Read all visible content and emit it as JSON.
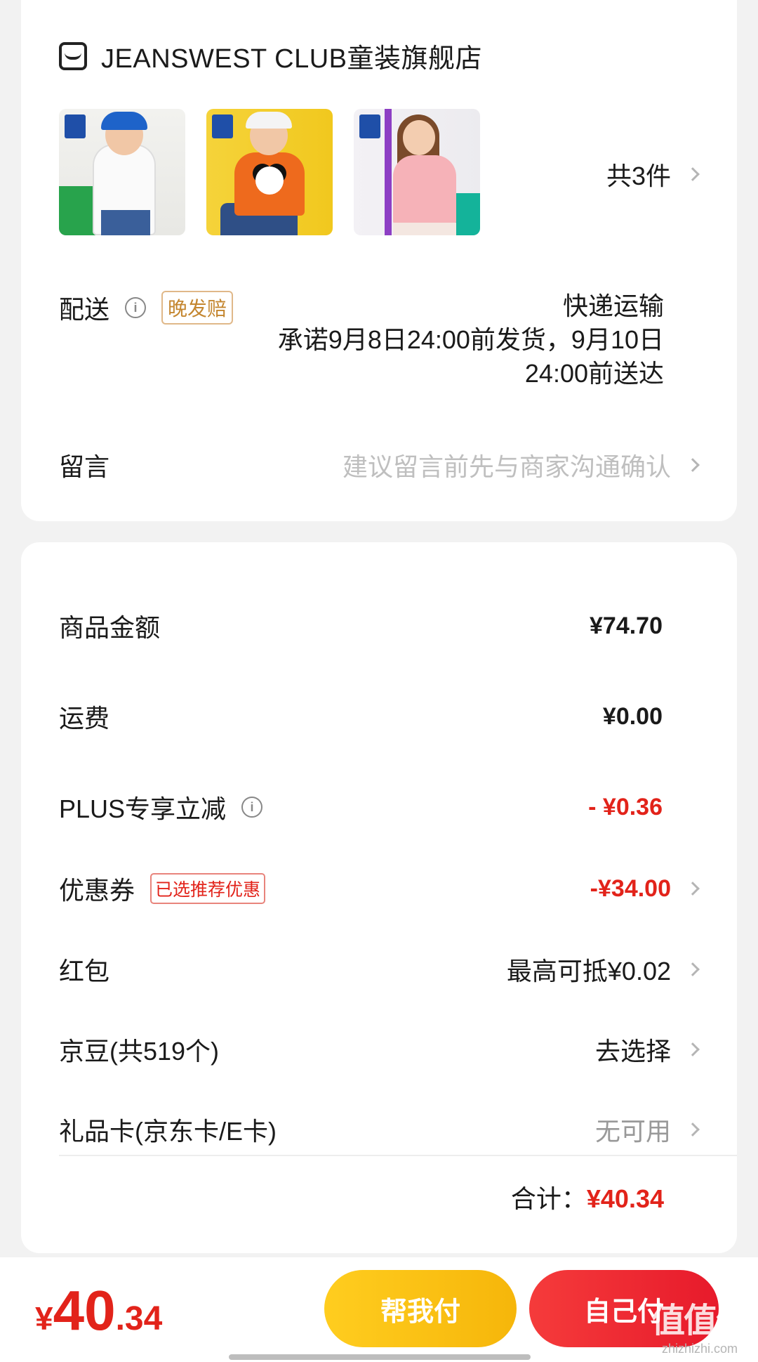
{
  "store": {
    "name": "JEANSWEST CLUB童装旗舰店",
    "icon": "store-icon",
    "item_count": "共3件",
    "thumbnails": [
      "product-boy-white-sweatshirt",
      "product-boy-orange-panda-sweatshirt",
      "product-girl-pink-sweatshirt"
    ]
  },
  "delivery": {
    "label": "配送",
    "tag": "晚发赔",
    "method": "快递运输",
    "promise_line1": "承诺9月8日24:00前发货，9月10日",
    "promise_line2": "24:00前送达"
  },
  "message": {
    "label": "留言",
    "placeholder": "建议留言前先与商家沟通确认"
  },
  "price": {
    "goods_label": "商品金额",
    "goods_value": "¥74.70",
    "shipping_label": "运费",
    "shipping_value": "¥0.00",
    "plus_label": "PLUS专享立减",
    "plus_value": "- ¥0.36",
    "coupon_label": "优惠券",
    "coupon_tag": "已选推荐优惠",
    "coupon_value": "-¥34.00",
    "redpacket_label": "红包",
    "redpacket_value": "最高可抵¥0.02",
    "jingdou_label": "京豆(共519个)",
    "jingdou_value": "去选择",
    "giftcard_label": "礼品卡(京东卡/E卡)",
    "giftcard_value": "无可用",
    "total_label": "合计：",
    "total_value": "¥40.34"
  },
  "bottom": {
    "amount_currency": "¥",
    "amount_integer": "40",
    "amount_decimal": ".34",
    "help_pay": "帮我付",
    "self_pay": "自己付",
    "watermark_glyph": "值值值",
    "watermark_url": "zhizhizhi.com"
  },
  "colors": {
    "accent_red": "#e2231a",
    "help_button": "#f6b60a",
    "self_button": "#e71a2b",
    "tag_gold": "#c4862f"
  }
}
